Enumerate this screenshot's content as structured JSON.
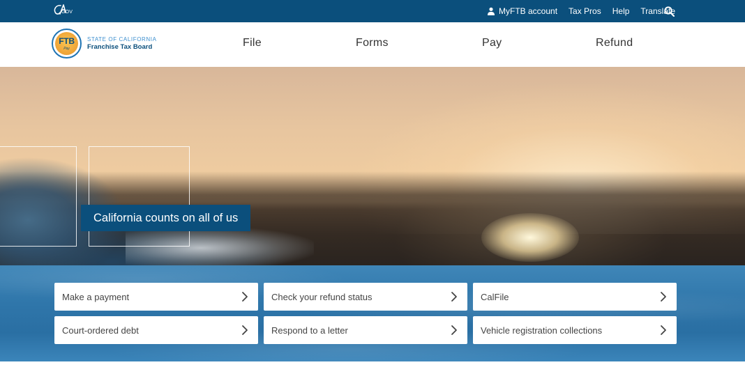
{
  "utility_bar": {
    "logo_text": "GOV",
    "links": [
      {
        "label": "MyFTB account",
        "icon": "user-icon"
      },
      {
        "label": "Tax Pros"
      },
      {
        "label": "Help"
      },
      {
        "label": "Translate"
      }
    ],
    "search_icon": "search-icon"
  },
  "header": {
    "seal": {
      "text": "FTB",
      "sub": "Pay"
    },
    "agency": {
      "state": "STATE OF CALIFORNIA",
      "board": "Franchise Tax Board"
    },
    "nav": [
      {
        "label": "File"
      },
      {
        "label": "Forms"
      },
      {
        "label": "Pay"
      },
      {
        "label": "Refund"
      }
    ]
  },
  "hero": {
    "caption": "California counts on all of us"
  },
  "quick_links": [
    {
      "label": "Make a payment"
    },
    {
      "label": "Check your refund status"
    },
    {
      "label": "CalFile"
    },
    {
      "label": "Court-ordered debt"
    },
    {
      "label": "Respond to a letter"
    },
    {
      "label": "Vehicle registration collections"
    }
  ],
  "colors": {
    "primary": "#0b4f7c",
    "accent": "#3d8fcf",
    "band": "#2f76aa"
  }
}
